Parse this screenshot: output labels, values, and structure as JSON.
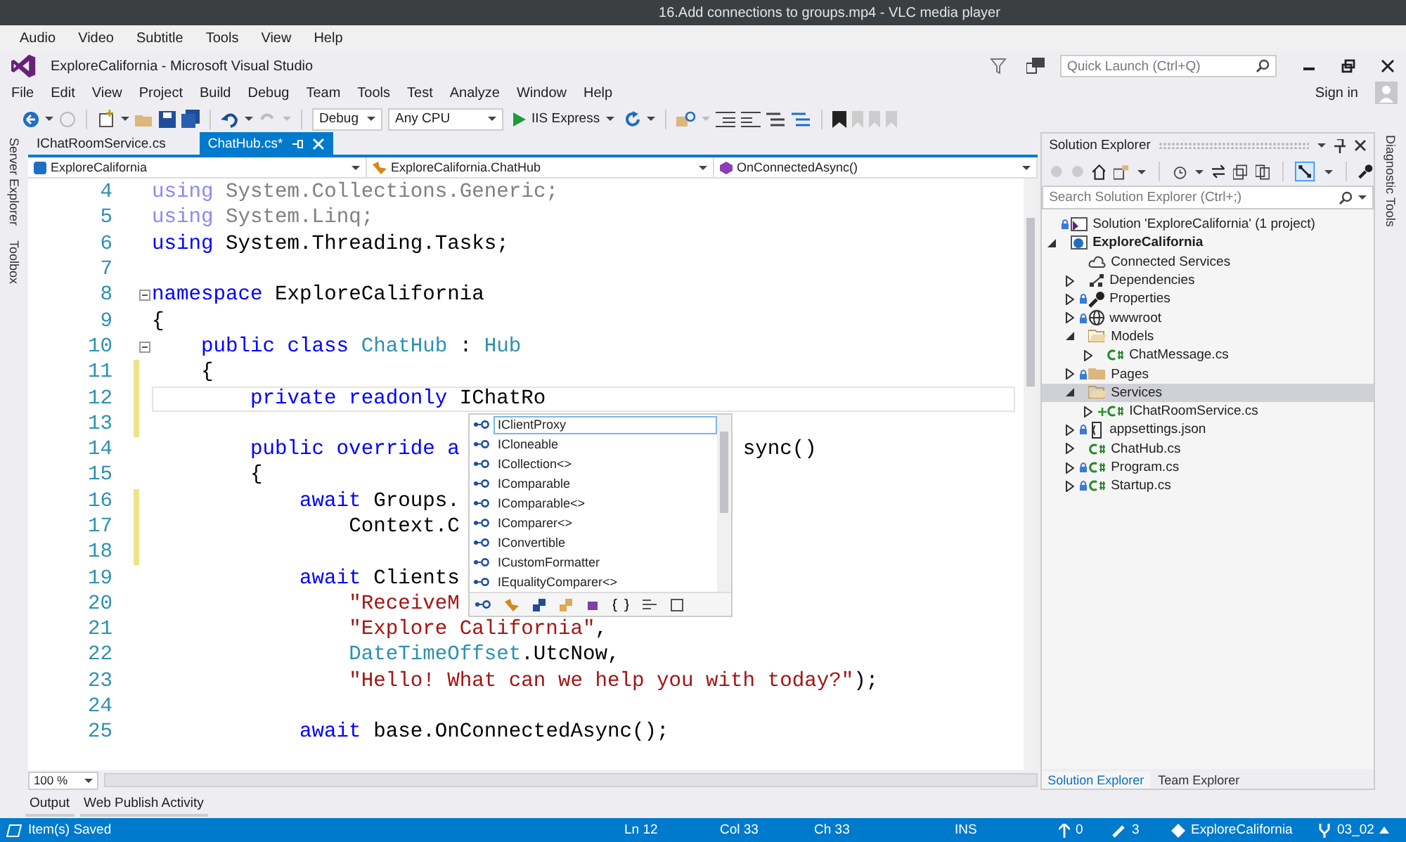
{
  "player_window": {
    "title": "16.Add connections to groups.mp4 - VLC media player",
    "menu": [
      "Audio",
      "Video",
      "Subtitle",
      "Tools",
      "View",
      "Help"
    ]
  },
  "ide": {
    "title": "ExploreCalifornia - Microsoft Visual Studio",
    "quick_launch": {
      "placeholder": "Quick Launch (Ctrl+Q)"
    },
    "menu": [
      "File",
      "Edit",
      "View",
      "Project",
      "Build",
      "Debug",
      "Team",
      "Tools",
      "Test",
      "Analyze",
      "Window",
      "Help"
    ],
    "sign_in": "Sign in",
    "toolbar": {
      "configuration": "Debug",
      "platform": "Any CPU",
      "run_target": "IIS Express"
    },
    "side_tabs_left": [
      "Server Explorer",
      "Toolbox"
    ],
    "side_tabs_right": [
      "Diagnostic Tools"
    ]
  },
  "editor": {
    "tabs": [
      {
        "label": "IChatRoomService.cs",
        "selected": false
      },
      {
        "label": "ChatHub.cs*",
        "selected": true
      }
    ],
    "nav": [
      "ExploreCalifornia",
      "ExploreCalifornia.ChatHub",
      "OnConnectedAsync()"
    ],
    "lines": [
      {
        "number": "4",
        "changed": false,
        "current": false,
        "fold": false,
        "segments": [
          {
            "kind": "kw-dim",
            "text": "using"
          },
          {
            "kind": "dim",
            "text": " System.Collections.Generic;"
          }
        ]
      },
      {
        "number": "5",
        "changed": false,
        "current": false,
        "fold": false,
        "segments": [
          {
            "kind": "kw-dim",
            "text": "using"
          },
          {
            "kind": "dim",
            "text": " System.Linq;"
          }
        ]
      },
      {
        "number": "6",
        "changed": false,
        "current": false,
        "fold": false,
        "segments": [
          {
            "kind": "kw",
            "text": "using"
          },
          {
            "kind": "plain",
            "text": " System.Threading.Tasks;"
          }
        ]
      },
      {
        "number": "7",
        "changed": false,
        "current": false,
        "fold": false
      },
      {
        "number": "8",
        "changed": false,
        "current": false,
        "fold": true,
        "segments": [
          {
            "kind": "kw",
            "text": "namespace"
          },
          {
            "kind": "plain",
            "text": " ExploreCalifornia"
          }
        ]
      },
      {
        "number": "9",
        "changed": false,
        "current": false,
        "fold": false,
        "segments": [
          {
            "kind": "plain",
            "text": "{"
          }
        ],
        "children": [
          {
            "number": "10",
            "changed": false,
            "current": false,
            "fold": true,
            "segments": [
              {
                "kind": "kw",
                "text": "public class"
              },
              {
                "kind": "type",
                "text": " ChatHub"
              },
              {
                "kind": "plain",
                "text": " : "
              },
              {
                "kind": "type",
                "text": "Hub"
              }
            ]
          },
          {
            "number": "11",
            "changed": true,
            "current": false,
            "fold": false,
            "segments": [
              {
                "kind": "plain",
                "text": "{"
              }
            ],
            "children": [
              {
                "number": "12",
                "changed": true,
                "current": true,
                "fold": false,
                "segments": [
                  {
                    "kind": "kw",
                    "text": "private readonly"
                  },
                  {
                    "kind": "plain",
                    "text": " IChatRo"
                  }
                ]
              },
              {
                "number": "13",
                "changed": true,
                "current": false,
                "fold": false
              },
              {
                "number": "14",
                "changed": false,
                "current": false,
                "fold": false,
                "segments": [
                  {
                    "kind": "kw",
                    "text": "public override a"
                  }
                ],
                "tail": "sync()"
              },
              {
                "number": "15",
                "changed": false,
                "current": false,
                "fold": false,
                "segments": [
                  {
                    "kind": "plain",
                    "text": "{"
                  }
                ],
                "children": [
                  {
                    "number": "16",
                    "changed": true,
                    "current": false,
                    "fold": false,
                    "segments": [
                      {
                        "kind": "kw",
                        "text": "await"
                      },
                      {
                        "kind": "plain",
                        "text": " Groups."
                      }
                    ],
                    "children": [
                      {
                        "number": "17",
                        "changed": true,
                        "current": false,
                        "fold": false,
                        "segments": [
                          {
                            "kind": "plain",
                            "text": "Context.C"
                          }
                        ]
                      }
                    ]
                  },
                  {
                    "number": "18",
                    "changed": true,
                    "current": false,
                    "fold": false
                  },
                  {
                    "number": "19",
                    "changed": false,
                    "current": false,
                    "fold": false,
                    "segments": [
                      {
                        "kind": "kw",
                        "text": "await"
                      },
                      {
                        "kind": "plain",
                        "text": " Clients"
                      }
                    ],
                    "children": [
                      {
                        "number": "20",
                        "changed": false,
                        "current": false,
                        "fold": false,
                        "segments": [
                          {
                            "kind": "str",
                            "text": "\"ReceiveM"
                          }
                        ]
                      },
                      {
                        "number": "21",
                        "changed": false,
                        "current": false,
                        "fold": false,
                        "segments": [
                          {
                            "kind": "str",
                            "text": "\"Explore California\""
                          },
                          {
                            "kind": "plain",
                            "text": ","
                          }
                        ]
                      },
                      {
                        "number": "22",
                        "changed": false,
                        "current": false,
                        "fold": false,
                        "segments": [
                          {
                            "kind": "type",
                            "text": "DateTimeOffset"
                          },
                          {
                            "kind": "plain",
                            "text": ".UtcNow,"
                          }
                        ]
                      },
                      {
                        "number": "23",
                        "changed": false,
                        "current": false,
                        "fold": false,
                        "segments": [
                          {
                            "kind": "str",
                            "text": "\"Hello! What can we help you with today?\""
                          },
                          {
                            "kind": "plain",
                            "text": ");"
                          }
                        ]
                      }
                    ]
                  },
                  {
                    "number": "24",
                    "changed": false,
                    "current": false,
                    "fold": false
                  },
                  {
                    "number": "25",
                    "changed": false,
                    "current": false,
                    "fold": false,
                    "segments": [
                      {
                        "kind": "kw",
                        "text": "await"
                      },
                      {
                        "kind": "plain",
                        "text": " base.OnConnectedAsync();"
                      }
                    ]
                  }
                ]
              }
            ]
          }
        ]
      }
    ],
    "completion": {
      "items": [
        {
          "label": "IClientProxy",
          "selected": true
        },
        {
          "label": "ICloneable",
          "selected": false
        },
        {
          "label": "ICollection<>",
          "selected": false
        },
        {
          "label": "IComparable",
          "selected": false
        },
        {
          "label": "IComparable<>",
          "selected": false
        },
        {
          "label": "IComparer<>",
          "selected": false
        },
        {
          "label": "IConvertible",
          "selected": false
        },
        {
          "label": "ICustomFormatter",
          "selected": false
        },
        {
          "label": "IEqualityComparer<>",
          "selected": false
        }
      ]
    },
    "zoom": "100 %"
  },
  "solution_explorer": {
    "title": "Solution Explorer",
    "search": {
      "placeholder": "Search Solution Explorer (Ctrl+;)"
    },
    "tree": [
      {
        "label": "Solution 'ExploreCalifornia' (1 project)",
        "kind": "solution",
        "selected": false,
        "locked": true,
        "added": false
      },
      {
        "label": "ExploreCalifornia",
        "kind": "project",
        "expanded": true,
        "selected": false,
        "locked": false,
        "added": false,
        "children": [
          {
            "label": "Connected Services",
            "kind": "cloud",
            "selected": false,
            "locked": false,
            "added": false
          },
          {
            "label": "Dependencies",
            "kind": "dependencies",
            "expanded": false,
            "selected": false,
            "locked": false,
            "added": false
          },
          {
            "label": "Properties",
            "kind": "properties",
            "expanded": false,
            "selected": false,
            "locked": true,
            "added": false
          },
          {
            "label": "wwwroot",
            "kind": "web",
            "expanded": false,
            "selected": false,
            "locked": true,
            "added": false
          },
          {
            "label": "Models",
            "kind": "folder",
            "expanded": true,
            "selected": false,
            "locked": false,
            "added": false,
            "children": [
              {
                "label": "ChatMessage.cs",
                "kind": "csharp",
                "expanded": false,
                "selected": false,
                "locked": false,
                "added": false
              }
            ]
          },
          {
            "label": "Pages",
            "kind": "folder",
            "expanded": false,
            "selected": false,
            "locked": true,
            "added": false
          },
          {
            "label": "Services",
            "kind": "folder",
            "expanded": true,
            "selected": true,
            "locked": false,
            "added": false,
            "children": [
              {
                "label": "IChatRoomService.cs",
                "kind": "csharp",
                "expanded": false,
                "selected": false,
                "locked": false,
                "added": true
              }
            ]
          },
          {
            "label": "appsettings.json",
            "kind": "json",
            "expanded": false,
            "selected": false,
            "locked": true,
            "added": false
          },
          {
            "label": "ChatHub.cs",
            "kind": "csharp",
            "expanded": false,
            "selected": false,
            "locked": false,
            "added": false
          },
          {
            "label": "Program.cs",
            "kind": "csharp",
            "expanded": false,
            "selected": false,
            "locked": true,
            "added": false
          },
          {
            "label": "Startup.cs",
            "kind": "csharp",
            "expanded": false,
            "selected": false,
            "locked": true,
            "added": false
          }
        ]
      }
    ],
    "tabs": [
      {
        "label": "Solution Explorer",
        "selected": true
      },
      {
        "label": "Team Explorer",
        "selected": false
      }
    ]
  },
  "output_tabs": [
    "Output",
    "Web Publish Activity"
  ],
  "status_bar": {
    "message": "Item(s) Saved",
    "line": "Ln 12",
    "column": "Col 33",
    "char": "Ch 33",
    "mode": "INS",
    "incoming": "0",
    "edits": "3",
    "repository": "ExploreCalifornia",
    "branch": "03_02"
  }
}
